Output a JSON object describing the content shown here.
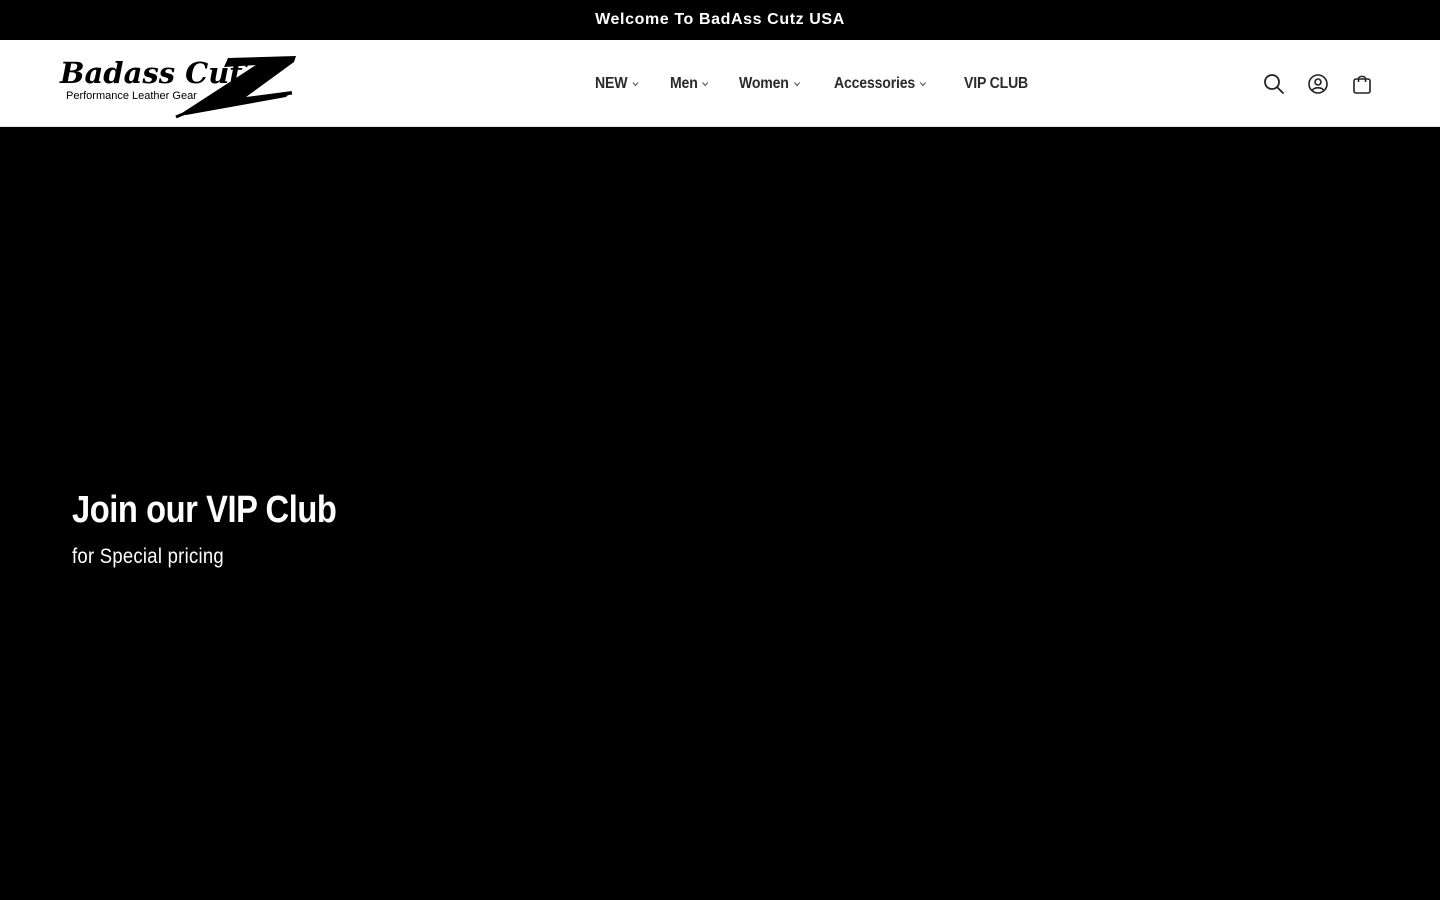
{
  "announcement": {
    "text": "Welcome To BadAss Cutz USA"
  },
  "logo": {
    "brand": "Badass CutZ",
    "tagline": "Performance Leather Gear"
  },
  "nav": {
    "items": [
      {
        "label": "NEW",
        "has_dropdown": true
      },
      {
        "label": "Men",
        "has_dropdown": true
      },
      {
        "label": "Women",
        "has_dropdown": true
      },
      {
        "label": "Accessories",
        "has_dropdown": true
      },
      {
        "label": "VIP CLUB",
        "has_dropdown": false
      }
    ]
  },
  "header_icons": [
    "search-icon",
    "account-icon",
    "cart-icon"
  ],
  "hero": {
    "title": "Join our VIP Club",
    "subtitle": "for Special pricing",
    "background_color": "#000000"
  },
  "colors": {
    "announcement_bg": "#000000",
    "header_bg": "#ffffff",
    "text_dark": "#2b2b2b",
    "text_light": "#ffffff"
  }
}
